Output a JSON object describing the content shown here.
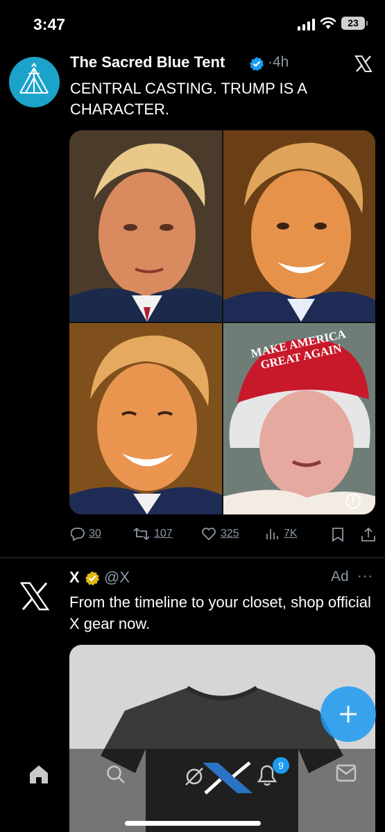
{
  "status": {
    "time": "3:47",
    "battery": "23"
  },
  "post": {
    "author_name": "The Sacred Blue Tent",
    "age": "·4h",
    "text": "CENTRAL CASTING. TRUMP IS A CHARACTER.",
    "image_text": "MAKE AMERICA GREAT AGAIN",
    "actions": {
      "replies": "30",
      "reposts": "107",
      "likes": "325",
      "views": "7K"
    }
  },
  "ad": {
    "name": "X",
    "handle": "@X",
    "label": "Ad",
    "more": "···",
    "text": "From the timeline to your closet, shop official X gear now."
  },
  "nav": {
    "notifications_count": "9"
  },
  "colors": {
    "accent": "#1d9bf0",
    "verified": "#1d9bf0",
    "gold": "#e2b719",
    "muted": "#8b98a5",
    "avatar_bg": "#1ba3c9"
  },
  "icons": [
    "wifi-icon",
    "signal-icon",
    "battery-icon",
    "tent-logo-icon",
    "verified-icon",
    "x-logo-icon",
    "reply-icon",
    "repost-icon",
    "like-icon",
    "views-icon",
    "bookmark-icon",
    "share-icon",
    "gold-checkmark-icon",
    "plus-icon",
    "home-icon",
    "search-icon",
    "grok-icon",
    "bell-icon",
    "mail-icon"
  ]
}
